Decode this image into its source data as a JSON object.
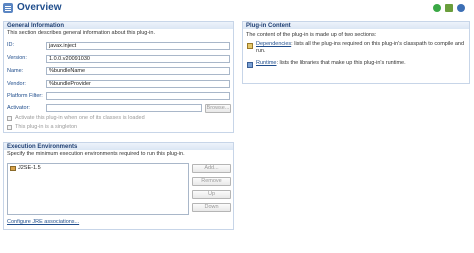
{
  "header": {
    "title": "Overview",
    "icons": [
      "run-icon",
      "debug-icon",
      "help-icon"
    ]
  },
  "general": {
    "title": "General Information",
    "description": "This section describes general information about this plug-in.",
    "fields": {
      "id": {
        "label": "ID:",
        "value": "javax.inject"
      },
      "version": {
        "label": "Version:",
        "value": "1.0.0.v20091030"
      },
      "name": {
        "label": "Name:",
        "value": "%bundleName"
      },
      "vendor": {
        "label": "Vendor:",
        "value": "%bundleProvider"
      },
      "platform_filter": {
        "label": "Platform Filter:",
        "value": ""
      },
      "activator": {
        "label": "Activator:",
        "value": ""
      }
    },
    "browse_label": "Browse...",
    "activate_label": "Activate this plug-in when one of its classes is loaded",
    "singleton_label": "This plug-in is a singleton"
  },
  "execution": {
    "title": "Execution Environments",
    "description": "Specify the minimum execution environments required to run this plug-in.",
    "items": [
      "J2SE-1.5"
    ],
    "buttons": {
      "add": "Add...",
      "remove": "Remove",
      "up": "Up",
      "down": "Down"
    },
    "configure_link": "Configure JRE associations..."
  },
  "content": {
    "title": "Plug-in Content",
    "intro": "The content of the plug-in is made up of two sections:",
    "dependencies_link": "Dependencies",
    "dependencies_text": ": lists all the plug-ins required on this plug-in's classpath to compile and run.",
    "runtime_link": "Runtime",
    "runtime_text": ": lists the libraries that make up this plug-in's runtime."
  }
}
